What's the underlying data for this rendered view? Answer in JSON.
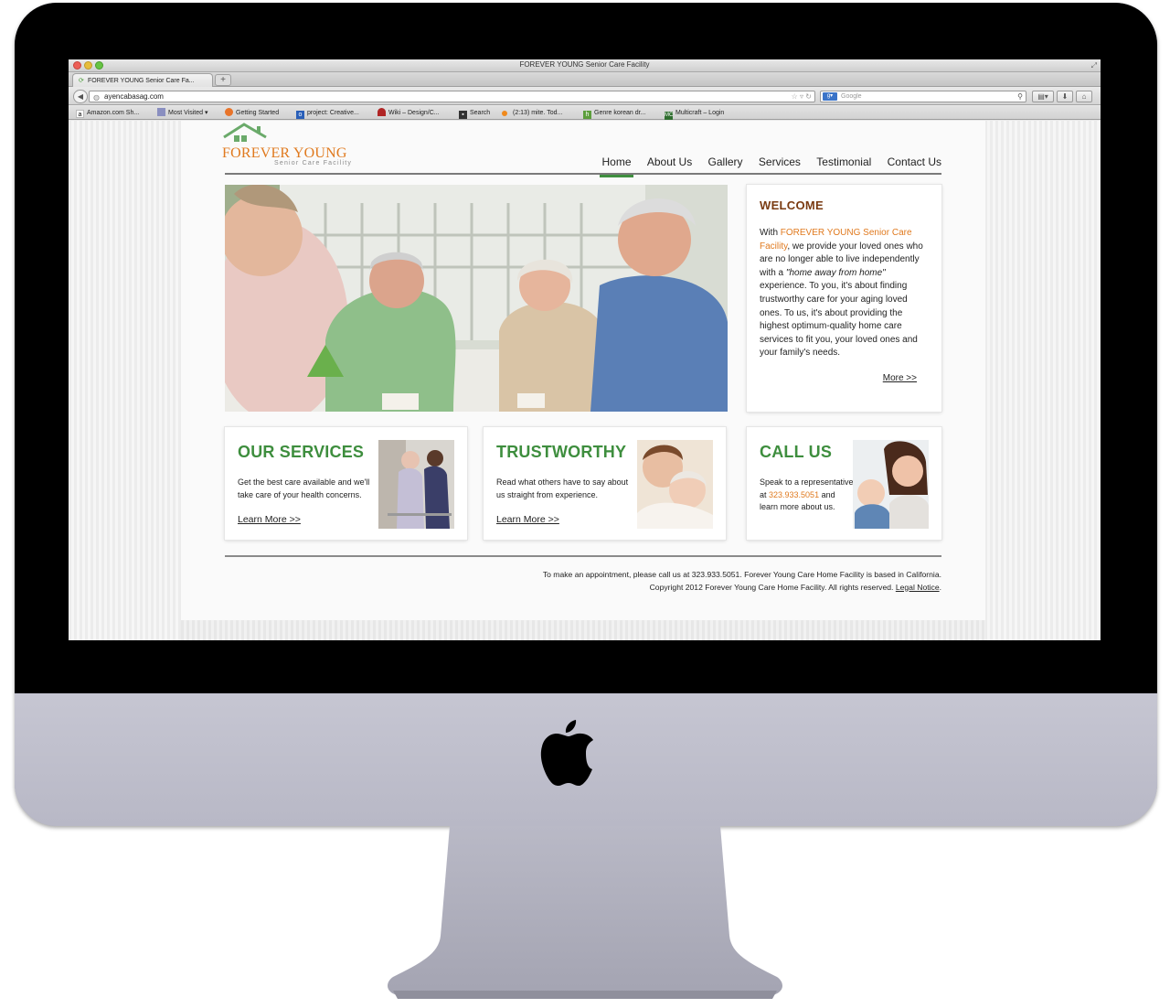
{
  "browser": {
    "window_title": "FOREVER YOUNG Senior Care Facility",
    "tab_title": "FOREVER YOUNG Senior Care Fa...",
    "url": "ayencabasag.com",
    "search_placeholder": "Google",
    "bookmarks": [
      {
        "label": "Amazon.com Sh...",
        "icon": "amazon-icon"
      },
      {
        "label": "Most Visited ▾",
        "icon": "folder-icon"
      },
      {
        "label": "Getting Started",
        "icon": "firefox-icon"
      },
      {
        "label": "project: Creative...",
        "icon": "project-icon"
      },
      {
        "label": "Wiki – Design/C...",
        "icon": "wiki-icon"
      },
      {
        "label": "Search",
        "icon": "search-page-icon"
      },
      {
        "label": "(2:13) mite. Tod...",
        "icon": "dot-icon"
      },
      {
        "label": "Genre korean dr...",
        "icon": "h-icon"
      },
      {
        "label": "Multicraft – Login",
        "icon": "mc-icon"
      }
    ]
  },
  "site": {
    "logo": {
      "title": "FOREVER YOUNG",
      "subtitle": "Senior Care Facility"
    },
    "nav": [
      "Home",
      "About Us",
      "Gallery",
      "Services",
      "Testimonial",
      "Contact Us"
    ],
    "active_nav": "Home",
    "welcome": {
      "heading": "WELCOME",
      "text_prefix": "With ",
      "text_highlight": "FOREVER YOUNG Senior Care Facility",
      "text_mid": ", we provide your loved ones who are no longer able to live independently with a ",
      "text_italic": "\"home away from home\"",
      "text_suffix": " experience. To you, it's about finding trustworthy care for your aging loved ones. To us, it's about providing the highest optimum-quality home care services to fit you, your loved ones and your family's needs.",
      "more": "More >>"
    },
    "features": [
      {
        "title": "OUR SERVICES",
        "text": "Get the best care available and we'll take care of your health concerns.",
        "link": "Learn More >>"
      },
      {
        "title": "TRUSTWORTHY",
        "text": "Read what others have to say about us straight from experience.",
        "link": "Learn More >>"
      },
      {
        "title": "CALL US",
        "text_prefix": "Speak to a representative at ",
        "phone": "323.933.5051",
        "text_suffix": " and learn more about us."
      }
    ],
    "footer": {
      "line1": "To make an appointment, please call us at 323.933.5051. Forever Young Care Home Facility is based in California.",
      "line2": "Copyright 2012 Forever Young Care Home Facility. All rights reserved. ",
      "legal": "Legal Notice",
      "line2_end": "."
    }
  },
  "colors": {
    "brand_orange": "#e07a1f",
    "brand_green": "#3e8e3e",
    "welcome_brown": "#7a3b12"
  }
}
